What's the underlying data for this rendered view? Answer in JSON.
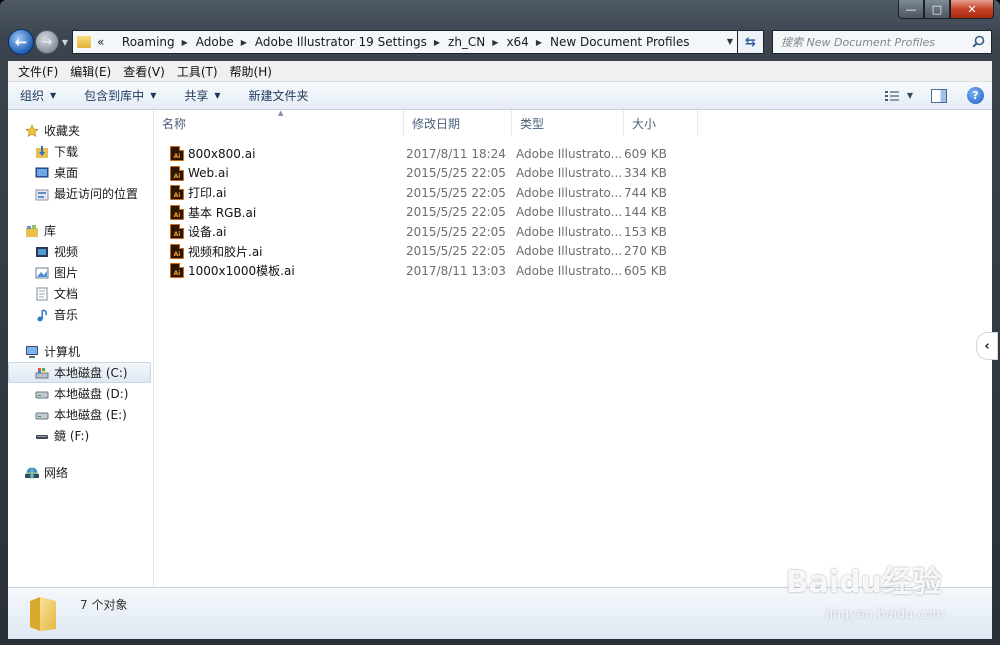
{
  "window": {
    "caption": {
      "minimize": "—",
      "maximize": "□",
      "close": "✕"
    }
  },
  "address": {
    "overflow": "«",
    "crumbs": [
      "Roaming",
      "Adobe",
      "Adobe Illustrator 19 Settings",
      "zh_CN",
      "x64",
      "New Document Profiles"
    ]
  },
  "search": {
    "placeholder": "搜索 New Document Profiles"
  },
  "menu": [
    "文件(F)",
    "编辑(E)",
    "查看(V)",
    "工具(T)",
    "帮助(H)"
  ],
  "commands": {
    "organize": "组织",
    "include_library": "包含到库中",
    "share": "共享",
    "new_folder": "新建文件夹"
  },
  "nav": {
    "favorites": {
      "label": "收藏夹",
      "items": [
        "下载",
        "桌面",
        "最近访问的位置"
      ]
    },
    "libraries": {
      "label": "库",
      "items": [
        "视频",
        "图片",
        "文档",
        "音乐"
      ]
    },
    "computer": {
      "label": "计算机",
      "items": [
        "本地磁盘 (C:)",
        "本地磁盘 (D:)",
        "本地磁盘 (E:)",
        "鏡 (F:)"
      ],
      "selected_index": 0
    },
    "network": {
      "label": "网络"
    }
  },
  "columns": {
    "name": "名称",
    "modified": "修改日期",
    "type": "类型",
    "size": "大小"
  },
  "files": [
    {
      "name": "800x800.ai",
      "modified": "2017/8/11 18:24",
      "type": "Adobe Illustrato...",
      "size": "609 KB"
    },
    {
      "name": "Web.ai",
      "modified": "2015/5/25 22:05",
      "type": "Adobe Illustrato...",
      "size": "334 KB"
    },
    {
      "name": "打印.ai",
      "modified": "2015/5/25 22:05",
      "type": "Adobe Illustrato...",
      "size": "744 KB"
    },
    {
      "name": "基本 RGB.ai",
      "modified": "2015/5/25 22:05",
      "type": "Adobe Illustrato...",
      "size": "144 KB"
    },
    {
      "name": "设备.ai",
      "modified": "2015/5/25 22:05",
      "type": "Adobe Illustrato...",
      "size": "153 KB"
    },
    {
      "name": "视频和胶片.ai",
      "modified": "2015/5/25 22:05",
      "type": "Adobe Illustrato...",
      "size": "270 KB"
    },
    {
      "name": "1000x1000模板.ai",
      "modified": "2017/8/11 13:03",
      "type": "Adobe Illustrato...",
      "size": "605 KB"
    }
  ],
  "file_icon_text": "Ai",
  "details": {
    "count": "7 个对象"
  },
  "watermark": {
    "logo": "Baidu经验",
    "url": "jingyan.baidu.com"
  },
  "colors": {
    "accent": "#1e395b",
    "selection": "#dfe8f3",
    "ai_icon": "#f4a02c"
  }
}
